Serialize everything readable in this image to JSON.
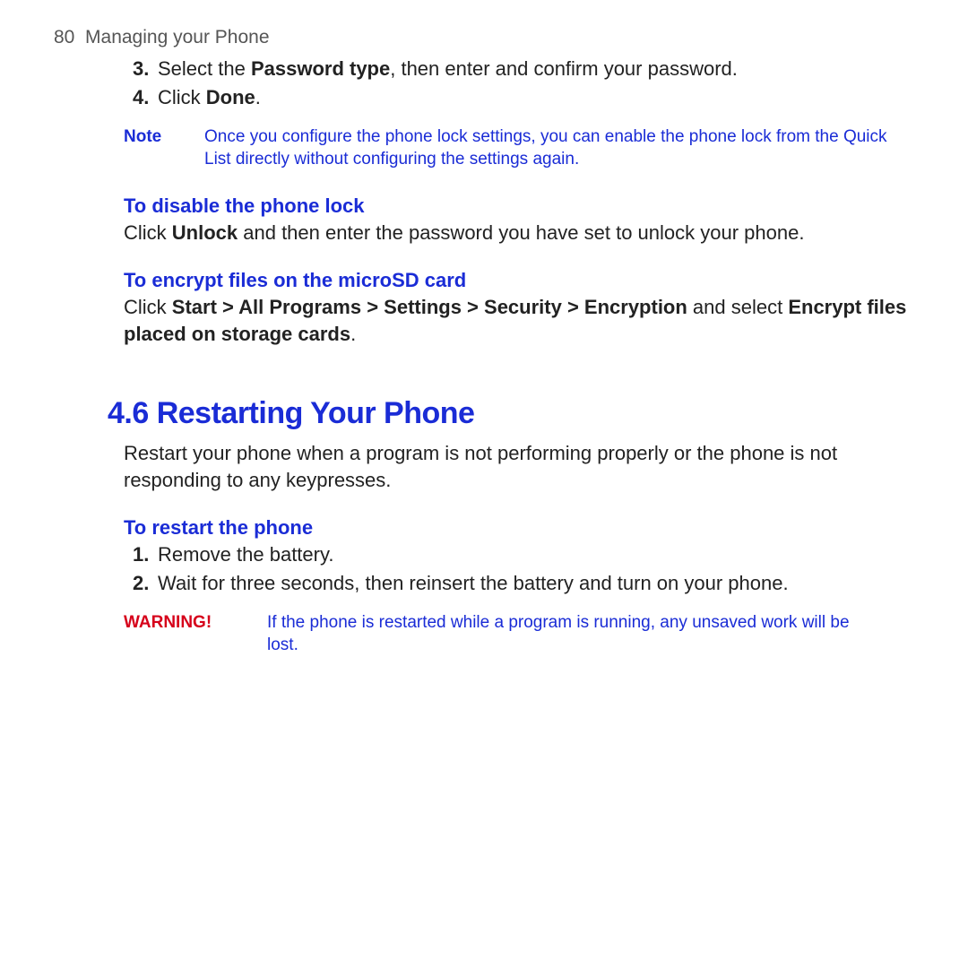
{
  "header": {
    "page_number": "80",
    "chapter": "Managing your Phone"
  },
  "steps_top": [
    {
      "n": "3.",
      "pre": "Select the ",
      "b1": "Password type",
      "post": ", then enter and confirm your password."
    },
    {
      "n": "4.",
      "pre": "Click ",
      "b1": "Done",
      "post": "."
    }
  ],
  "note1": {
    "label": "Note",
    "body": "Once you configure the phone lock settings, you can enable the phone lock from the Quick List directly without configuring the settings again."
  },
  "disable": {
    "heading": "To disable the phone lock",
    "pre": "Click ",
    "b1": "Unlock",
    "post": " and then enter the password you have set to unlock your phone."
  },
  "encrypt": {
    "heading": "To encrypt files on the microSD card",
    "pre": "Click ",
    "b1": "Start > All Programs > Settings > Security > Encryption",
    "mid": " and select ",
    "b2": "Encrypt files placed on storage cards",
    "post": "."
  },
  "section46": {
    "title": "4.6 Restarting Your Phone",
    "intro": "Restart your phone when a program is not performing properly or the phone is not responding to any keypresses.",
    "sub": "To restart the phone",
    "steps": [
      {
        "n": "1.",
        "text": "Remove the battery."
      },
      {
        "n": "2.",
        "text": "Wait for three seconds, then reinsert the battery and turn on your phone."
      }
    ],
    "warning": {
      "label": "WARNING!",
      "body": "If the phone is restarted while a program is running, any unsaved work will be lost."
    }
  }
}
